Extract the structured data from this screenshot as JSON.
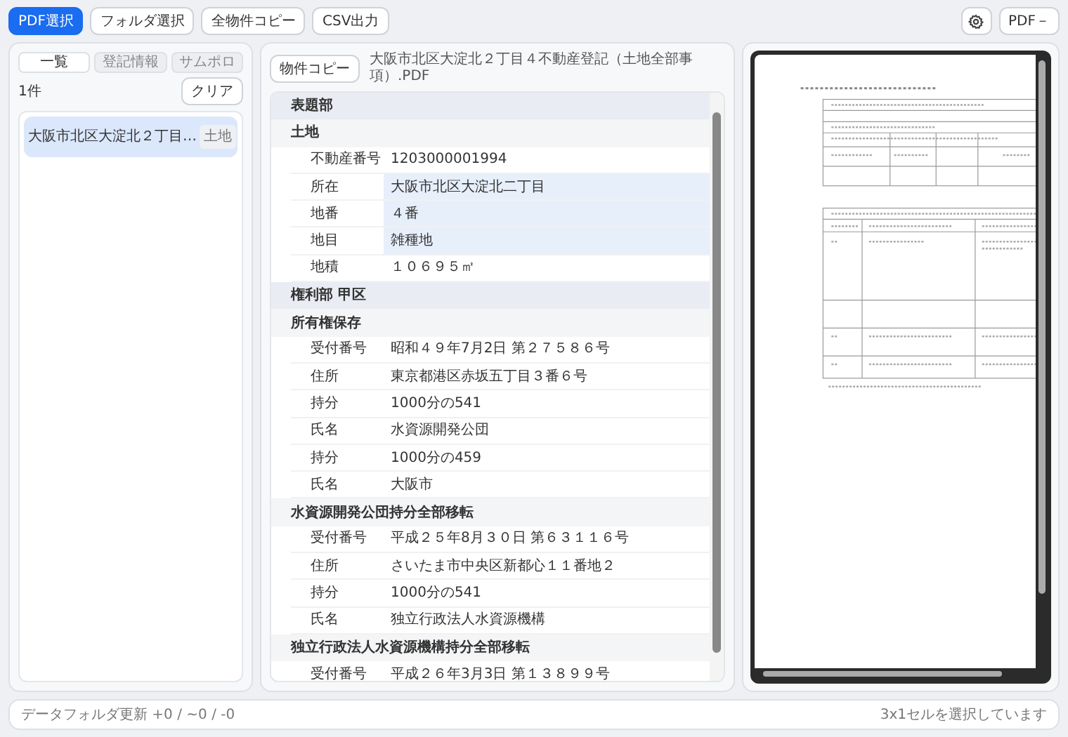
{
  "toolbar": {
    "buttons": [
      {
        "label": "PDF選択",
        "kind": "primary"
      },
      {
        "label": "フォルダ選択",
        "kind": "outline"
      },
      {
        "label": "全物件コピー",
        "kind": "outline"
      },
      {
        "label": "CSV出力",
        "kind": "outline"
      }
    ],
    "zoom_button": "PDF－"
  },
  "left_panel": {
    "tabs": [
      {
        "label": "一覧",
        "selected": true
      },
      {
        "label": "登記情報",
        "selected": false
      },
      {
        "label": "サムポロ",
        "selected": false
      }
    ],
    "count": "1件",
    "clear_button": "クリア",
    "items": [
      {
        "title": "大阪市北区大淀北２丁目…",
        "tag": "土地",
        "selected": true
      }
    ]
  },
  "middle_panel": {
    "copy_button": "物件コピー",
    "file_name": "大阪市北区大淀北２丁目４不動産登記（土地全部事項）.PDF",
    "rows": [
      {
        "kind": "part",
        "label": "表題部"
      },
      {
        "kind": "group",
        "label": "土地"
      },
      {
        "kind": "field",
        "label": "不動産番号",
        "value": "1203000001994",
        "selected": false
      },
      {
        "kind": "field",
        "label": "所在",
        "value": "大阪市北区大淀北二丁目",
        "selected": true
      },
      {
        "kind": "field",
        "label": "地番",
        "value": "４番",
        "selected": true
      },
      {
        "kind": "field",
        "label": "地目",
        "value": "雑種地",
        "selected": true
      },
      {
        "kind": "field",
        "label": "地積",
        "value": "１０６９５㎡",
        "selected": false
      },
      {
        "kind": "part",
        "label": "権利部 甲区"
      },
      {
        "kind": "group",
        "label": "所有権保存"
      },
      {
        "kind": "field",
        "label": "受付番号",
        "value": "昭和４９年7月2日 第２７５８６号",
        "selected": false
      },
      {
        "kind": "field",
        "label": "住所",
        "value": "東京都港区赤坂五丁目３番６号",
        "selected": false
      },
      {
        "kind": "field",
        "label": "持分",
        "value": "1000分の541",
        "selected": false
      },
      {
        "kind": "field",
        "label": "氏名",
        "value": "水資源開発公団",
        "selected": false
      },
      {
        "kind": "field",
        "label": "持分",
        "value": "1000分の459",
        "selected": false
      },
      {
        "kind": "field",
        "label": "氏名",
        "value": "大阪市",
        "selected": false
      },
      {
        "kind": "group",
        "label": "水資源開発公団持分全部移転"
      },
      {
        "kind": "field",
        "label": "受付番号",
        "value": "平成２５年8月３０日 第６３１１６号",
        "selected": false
      },
      {
        "kind": "field",
        "label": "住所",
        "value": "さいたま市中央区新都心１１番地２",
        "selected": false
      },
      {
        "kind": "field",
        "label": "持分",
        "value": "1000分の541",
        "selected": false
      },
      {
        "kind": "field",
        "label": "氏名",
        "value": "独立行政法人水資源機構",
        "selected": false
      },
      {
        "kind": "group",
        "label": "独立行政法人水資源機構持分全部移転"
      },
      {
        "kind": "field",
        "label": "受付番号",
        "value": "平成２６年3月3日 第１３８９９号",
        "selected": false
      }
    ]
  },
  "status_bar": {
    "left": "データフォルダ更新 +0 / ~0 / -0",
    "right": "3x1セルを選択しています"
  }
}
